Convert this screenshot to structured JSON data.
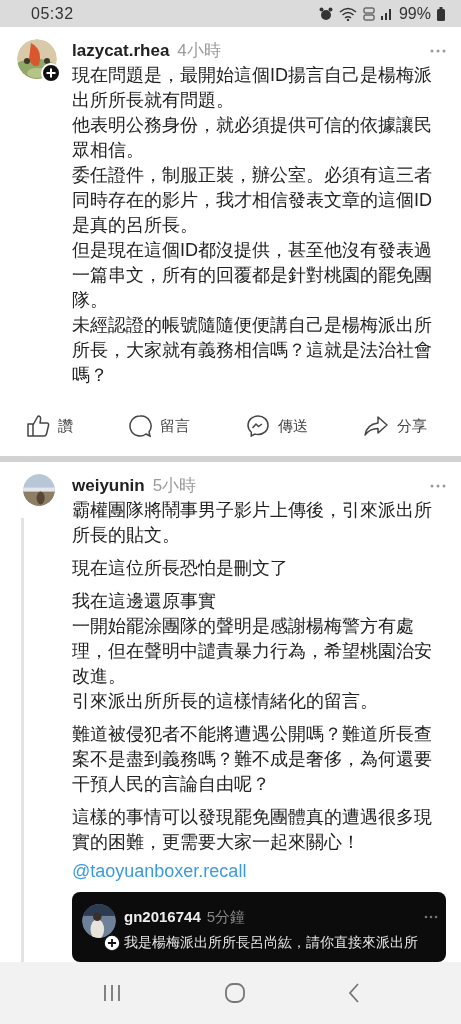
{
  "status_bar": {
    "time": "05:32",
    "battery": "99%"
  },
  "posts": [
    {
      "username": "lazycat.rhea",
      "time": "4小時",
      "follow_badge": true,
      "blocks": [
        [
          "現在問題是，最開始這個ID揚言自己是楊梅派出所所長就有問題。",
          "他表明公務身份，就必須提供可信的依據讓民眾相信。",
          "委任證件，制服正裝，辦公室。必須有這三者同時存在的影片，我才相信發表文章的這個ID是真的呂所長。",
          "但是現在這個ID都沒提供，甚至他沒有發表過一篇串文，所有的回覆都是針對桃園的罷免團隊。",
          "未經認證的帳號隨隨便便講自己是楊梅派出所所長，大家就有義務相信嗎？這就是法治社會嗎？"
        ]
      ],
      "actions": [
        {
          "kind": "like",
          "label": "讚"
        },
        {
          "kind": "comment",
          "label": "留言"
        },
        {
          "kind": "send",
          "label": "傳送"
        },
        {
          "kind": "share",
          "label": "分享"
        }
      ]
    },
    {
      "username": "weiyunin",
      "time": "5小時",
      "follow_badge": false,
      "blocks": [
        [
          "霸權團隊將鬧事男子影片上傳後，引來派出所所長的貼文。"
        ],
        [
          "現在這位所長恐怕是刪文了"
        ],
        [
          "我在這邊還原事實",
          "一開始罷涂團隊的聲明是感謝楊梅警方有處理，但在聲明中譴責暴力行為，希望桃園治安改進。",
          "引來派出所所長的這樣情緒化的留言。"
        ],
        [
          "難道被侵犯者不能將遭遇公開嗎？難道所長查案不是盡到義務嗎？難不成是奢侈，為何還要干預人民的言論自由呢？"
        ],
        [
          "這樣的事情可以發現罷免團體真的遭遇很多現實的困難，更需要大家一起來關心！"
        ]
      ],
      "mention": "@taoyuanboxer.recall",
      "quoted": {
        "username": "gn2016744",
        "time": "5分鐘",
        "follow_badge": true,
        "text": "我是楊梅派出所所長呂尚紘，請你直接來派出所"
      }
    }
  ]
}
